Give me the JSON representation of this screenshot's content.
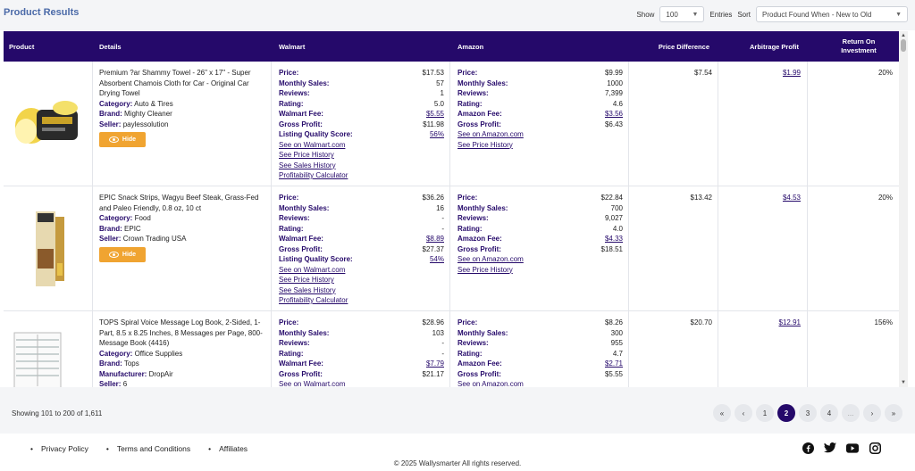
{
  "page_title": "Product Results",
  "controls": {
    "show_label": "Show",
    "entries_value": "100",
    "entries_label": "Entries",
    "sort_label": "Sort",
    "sort_value": "Product Found When - New to Old"
  },
  "headers": {
    "product": "Product",
    "details": "Details",
    "walmart": "Walmart",
    "amazon": "Amazon",
    "price_difference": "Price Difference",
    "arbitrage_profit": "Arbitrage Profit",
    "roi": "Return On Investment"
  },
  "labels": {
    "category": "Category:",
    "brand": "Brand:",
    "seller": "Seller:",
    "manufacturer": "Manufacturer:",
    "hide": "Hide",
    "price": "Price:",
    "monthly_sales": "Monthly Sales:",
    "reviews": "Reviews:",
    "rating": "Rating:",
    "walmart_fee": "Walmart Fee:",
    "amazon_fee": "Amazon Fee:",
    "gross_profit": "Gross Profit:",
    "listing_quality": "Listing Quality Score:",
    "see_walmart": "See on Walmart.com",
    "see_amazon": "See on Amazon.com",
    "price_history": "See Price History",
    "sales_history": "See Sales History",
    "profit_calc": "Profitability Calculator"
  },
  "rows": [
    {
      "title": "Premium ?ar Shammy Towel - 26\" x 17\" - Super Absorbent Chamois Cloth for Car - Original Car Drying Towel",
      "category": "Auto & Tires",
      "brand": "Mighty Cleaner",
      "seller": "paylessolution",
      "walmart": {
        "price": "$17.53",
        "monthly_sales": "57",
        "reviews": "1",
        "rating": "5.0",
        "fee": "$5.55",
        "gross_profit": "$11.98",
        "lqs": "56%"
      },
      "amazon": {
        "price": "$9.99",
        "monthly_sales": "1000",
        "reviews": "7,399",
        "rating": "4.6",
        "fee": "$3.56",
        "gross_profit": "$6.43"
      },
      "price_difference": "$7.54",
      "arbitrage_profit": "$1.99",
      "roi": "20%"
    },
    {
      "title": "EPIC Snack Strips, Wagyu Beef Steak, Grass-Fed and Paleo Friendly, 0.8 oz, 10 ct",
      "category": "Food",
      "brand": "EPIC",
      "seller": "Crown Trading USA",
      "walmart": {
        "price": "$36.26",
        "monthly_sales": "16",
        "reviews": "-",
        "rating": "-",
        "fee": "$8.89",
        "gross_profit": "$27.37",
        "lqs": "54%"
      },
      "amazon": {
        "price": "$22.84",
        "monthly_sales": "700",
        "reviews": "9,027",
        "rating": "4.0",
        "fee": "$4.33",
        "gross_profit": "$18.51"
      },
      "price_difference": "$13.42",
      "arbitrage_profit": "$4.53",
      "roi": "20%"
    },
    {
      "title": "TOPS Spiral Voice Message Log Book, 2-Sided, 1-Part, 8.5 x 8.25 Inches, 8 Messages per Page, 800-Message Book (4416)",
      "category": "Office Supplies",
      "brand": "Tops",
      "manufacturer": "DropAir",
      "seller": "6",
      "walmart": {
        "price": "$28.96",
        "monthly_sales": "103",
        "reviews": "-",
        "rating": "-",
        "fee": "$7.79",
        "gross_profit": "$21.17"
      },
      "amazon": {
        "price": "$8.26",
        "monthly_sales": "300",
        "reviews": "955",
        "rating": "4.7",
        "fee": "$2.71",
        "gross_profit": "$5.55"
      },
      "price_difference": "$20.70",
      "arbitrage_profit": "$12.91",
      "roi": "156%"
    }
  ],
  "pagination": {
    "showing": "Showing 101 to 200 of 1,611",
    "first": "«",
    "prev": "‹",
    "pages": [
      "1",
      "2",
      "3",
      "4",
      "..."
    ],
    "next": "›",
    "last": "»"
  },
  "footer": {
    "links": [
      "Privacy Policy",
      "Terms and Conditions",
      "Affiliates"
    ],
    "copyright": "© 2025 Wallysmarter All rights reserved.",
    "social_icons": [
      "facebook-icon",
      "twitter-icon",
      "youtube-icon",
      "instagram-icon"
    ]
  },
  "colors": {
    "header_bg": "#25096a",
    "accent": "#f0a431",
    "title": "#4b6aa8"
  }
}
